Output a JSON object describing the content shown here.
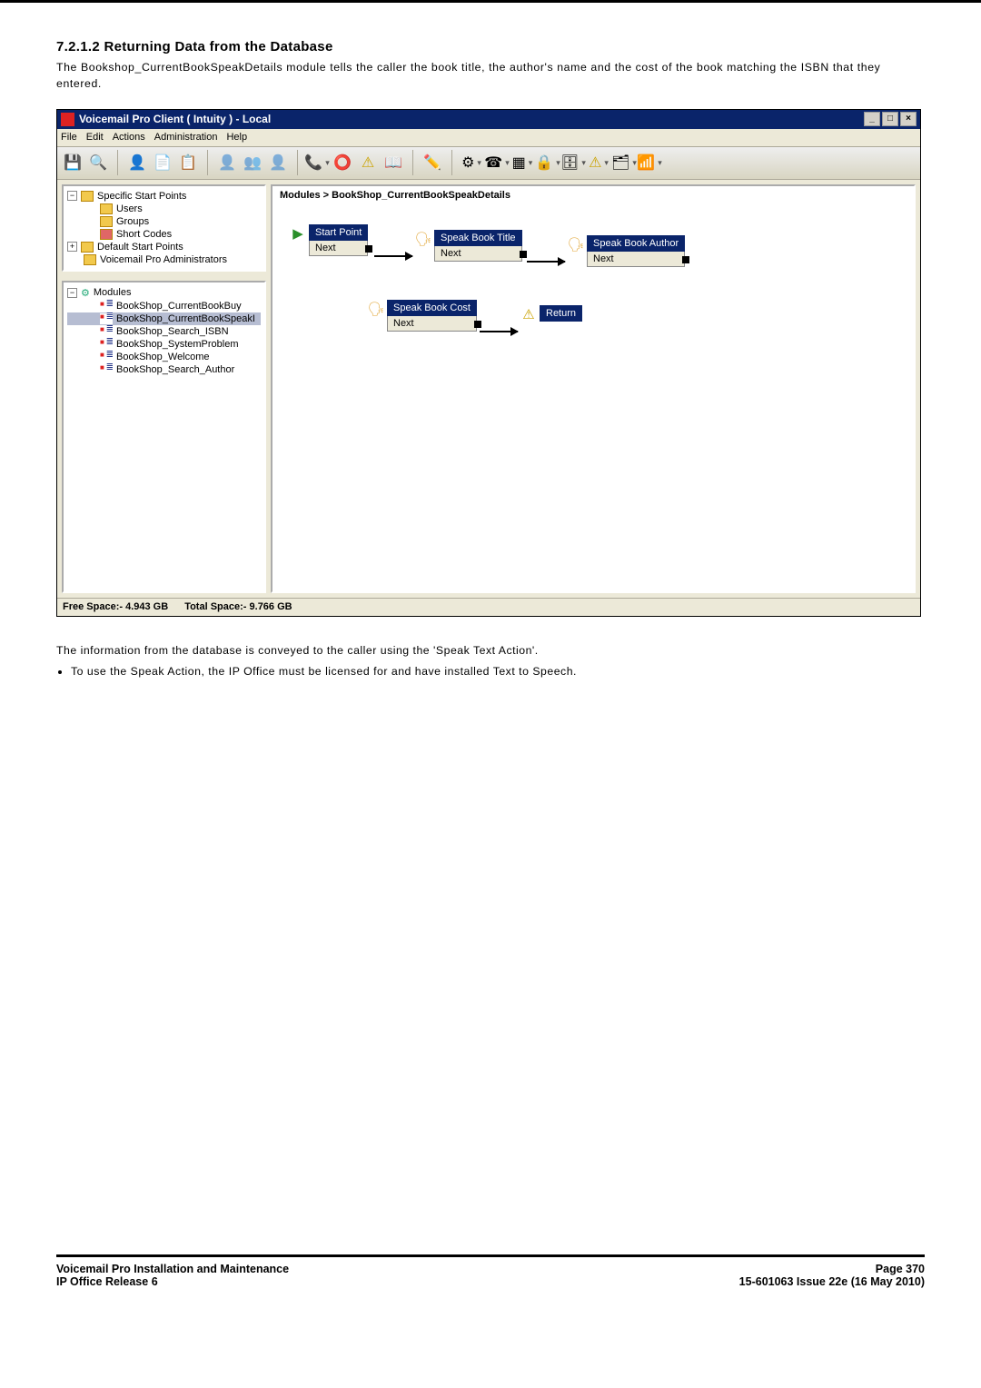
{
  "section": {
    "number": "7.2.1.2",
    "title": "Returning Data from the Database",
    "intro": "The Bookshop_CurrentBookSpeakDetails module tells the caller the book title, the author's name and the cost of the book matching the ISBN that they entered."
  },
  "window": {
    "title_prefix": "Voicemail Pro Client ",
    "title_mode": " ( Intuity ) - ",
    "title_suffix": "  Local",
    "controls": {
      "min": "_",
      "max": "□",
      "close": "×"
    }
  },
  "menu": {
    "items": [
      "File",
      "Edit",
      "Actions",
      "Administration",
      "Help"
    ]
  },
  "breadcrumb": "Modules > BookShop_CurrentBookSpeakDetails",
  "nodes": {
    "start": {
      "label": "Start Point",
      "next": "Next"
    },
    "title": {
      "label": "Speak Book Title",
      "next": "Next"
    },
    "author": {
      "label": "Speak Book Author",
      "next": "Next"
    },
    "cost": {
      "label": "Speak Book Cost",
      "next": "Next"
    },
    "return": {
      "label": "Return"
    }
  },
  "tree1": {
    "root": "Specific Start Points",
    "children": [
      "Users",
      "Groups",
      "Short Codes"
    ],
    "siblings": [
      "Default Start Points",
      "Voicemail Pro Administrators"
    ]
  },
  "tree2": {
    "root": "Modules",
    "items": [
      "BookShop_CurrentBookBuy",
      "BookShop_CurrentBookSpeakI",
      "BookShop_Search_ISBN",
      "BookShop_SystemProblem",
      "BookShop_Welcome",
      "BookShop_Search_Author"
    ]
  },
  "status": {
    "free_label": "Free Space:-",
    "free_value": "4.943 GB",
    "total_label": "Total Space:-",
    "total_value": "9.766 GB"
  },
  "post": {
    "para": "The information from the database is conveyed to the caller using the 'Speak Text Action'.",
    "bullet": "To use the Speak Action, the IP Office must be licensed for and have installed Text to Speech."
  },
  "footer": {
    "left1": "Voicemail Pro Installation and Maintenance",
    "left2": "IP Office Release 6",
    "right1": "Page 370",
    "right2": "15-601063 Issue 22e (16 May 2010)"
  },
  "toolbar_icons": [
    "save-icon",
    "prefs-icon",
    "users-icon",
    "copy-icon",
    "paste-icon",
    "person-add-icon",
    "person2-icon",
    "person-del-icon",
    "phone-icon",
    "record-icon",
    "alert-icon",
    "book-icon",
    "pencil-icon",
    "gear-icon",
    "phone2-icon",
    "grid-icon",
    "lock-icon",
    "db-icon",
    "tri-icon",
    "list-icon",
    "eq-icon"
  ]
}
